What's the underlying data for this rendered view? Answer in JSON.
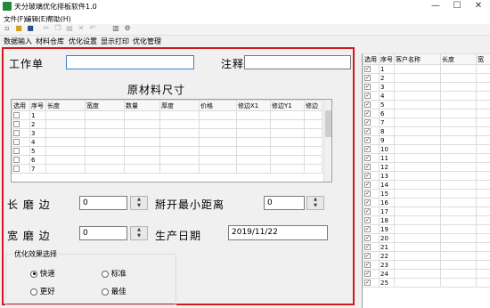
{
  "window": {
    "title": "天分玻璃优化排板软件1.0",
    "minimize": "—",
    "maximize": "☐",
    "close": "✕"
  },
  "menu": [
    "文件(F)",
    "编辑(E)",
    "帮助(H)"
  ],
  "toolbar_icons": [
    "new-file-icon",
    "open-folder-icon",
    "save-icon",
    "cut-icon",
    "copy-icon",
    "paste-icon",
    "delete-icon",
    "undo-icon",
    "print-icon",
    "tools-icon"
  ],
  "tabs": [
    "数据输入",
    "材料仓库",
    "优化设置",
    "显示打印",
    "优化管理"
  ],
  "form": {
    "work_order_label": "工作单",
    "work_order_value": "",
    "note_label": "注释",
    "note_value": "",
    "raw_material_title": "原材料尺寸",
    "long_edge_label": "长 磨 边",
    "long_edge_value": "0",
    "min_spacing_label": "掰开最小距离",
    "min_spacing_value": "0",
    "wide_edge_label": "宽 磨 边",
    "wide_edge_value": "0",
    "date_label": "生产日期",
    "date_value": "2019/11/22"
  },
  "material_table": {
    "columns": [
      "选用",
      "序号",
      "长度",
      "宽度",
      "数量",
      "厚度",
      "价格",
      "修边X1",
      "修边Y1",
      "修边"
    ],
    "rows": [
      "1",
      "2",
      "3",
      "4",
      "5",
      "6",
      "7"
    ]
  },
  "optimization": {
    "legend": "优化效果选择",
    "options": [
      "快速",
      "标准",
      "更好",
      "最佳"
    ],
    "selected": "快速"
  },
  "order_table": {
    "columns": [
      "选用",
      "序号",
      "客户名称",
      "长度",
      "宽"
    ],
    "rows": [
      "1",
      "2",
      "3",
      "4",
      "5",
      "6",
      "7",
      "8",
      "9",
      "10",
      "11",
      "12",
      "13",
      "14",
      "15",
      "16",
      "17",
      "18",
      "19",
      "20",
      "21",
      "22",
      "23",
      "24",
      "25"
    ]
  },
  "colors": {
    "highlight_border": "#d0191f",
    "app_icon": "#1f8a3a",
    "focus_border": "#3c7fc8"
  }
}
